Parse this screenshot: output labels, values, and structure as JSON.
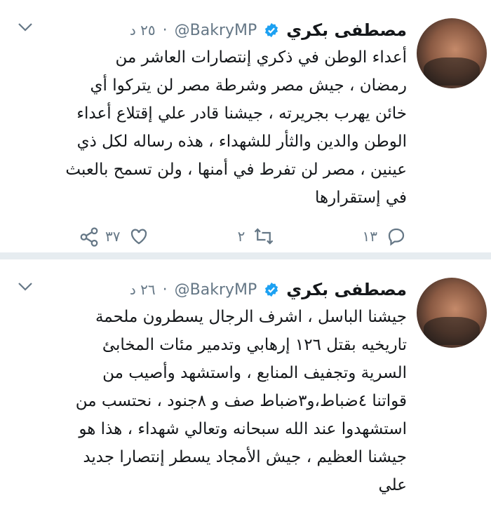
{
  "tweets": [
    {
      "name": "مصطفى بكري",
      "handle": "@BakryMP",
      "dot": "·",
      "time": "٢٥ د",
      "lines": [
        "أعداء الوطن في ذكري إنتصارات العاشر من",
        "رمضان ، جيش مصر وشرطة مصر لن يتركوا أي",
        "خائن يهرب بجريرته ، جيشنا قادر علي إقتلاع أعداء",
        "الوطن والدين والثأر للشهداء ، هذه رساله لكل ذي",
        "عينين ، مصر لن تفرط في أمنها ، ولن تسمح بالعبث",
        "في إستقرارها"
      ],
      "replies": "١٣",
      "retweets": "٢",
      "likes": "٣٧"
    },
    {
      "name": "مصطفى بكري",
      "handle": "@BakryMP",
      "dot": "·",
      "time": "٢٦ د",
      "lines": [
        "جيشنا الباسل ، اشرف الرجال يسطرون ملحمة",
        "تاريخيه بقتل ١٢٦ إرهابي وتدمير مئات المخابئ",
        "السرية وتجفيف المنابع ، واستشهد وأصيب من",
        "قواتنا ٤ضباط،و٣ضباط صف و ٨جنود ، نحتسب من",
        "استشهدوا عند الله سبحانه وتعالي شهداء ، هذا هو",
        "جيشنا العظيم ، جيش الأمجاد يسطر إنتصارا جديد",
        "علي"
      ]
    }
  ],
  "colors": {
    "verified": "#1da1f2",
    "muted": "#657786",
    "text": "#14171a"
  },
  "icons": [
    "reply-icon",
    "retweet-icon",
    "like-icon",
    "share-icon",
    "verified-badge-icon",
    "chevron-down-icon"
  ]
}
